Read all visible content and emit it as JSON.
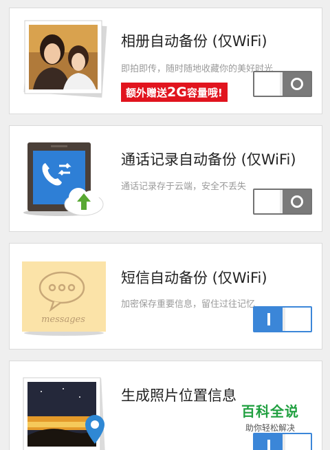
{
  "settings": [
    {
      "title": "相册自动备份 (仅WiFi)",
      "subtitle": "即拍即传，随时随地收藏你的美好时光",
      "enabled": false,
      "icon": "photo-album-icon"
    },
    {
      "title": "通话记录自动备份 (仅WiFi)",
      "subtitle": "通话记录存于云端，安全不丢失",
      "enabled": false,
      "icon": "call-log-cloud-icon"
    },
    {
      "title": "短信自动备份 (仅WiFi)",
      "subtitle": "加密保存重要信息，留住过往记忆",
      "enabled": true,
      "icon": "messages-note-icon",
      "icon_text": "messages"
    },
    {
      "title": "生成照片位置信息",
      "subtitle": "",
      "enabled": true,
      "icon": "photo-location-icon"
    }
  ],
  "promo": {
    "prefix": "额外赠送",
    "size": "2G",
    "suffix": "容量哦!"
  },
  "watermark": {
    "title": "百科全说",
    "subtitle": "助你轻松解决"
  },
  "colors": {
    "toggle_on": "#3b86d8",
    "toggle_off": "#7a7a7a",
    "promo_bg": "#e1141e",
    "watermark": "#20a040"
  }
}
